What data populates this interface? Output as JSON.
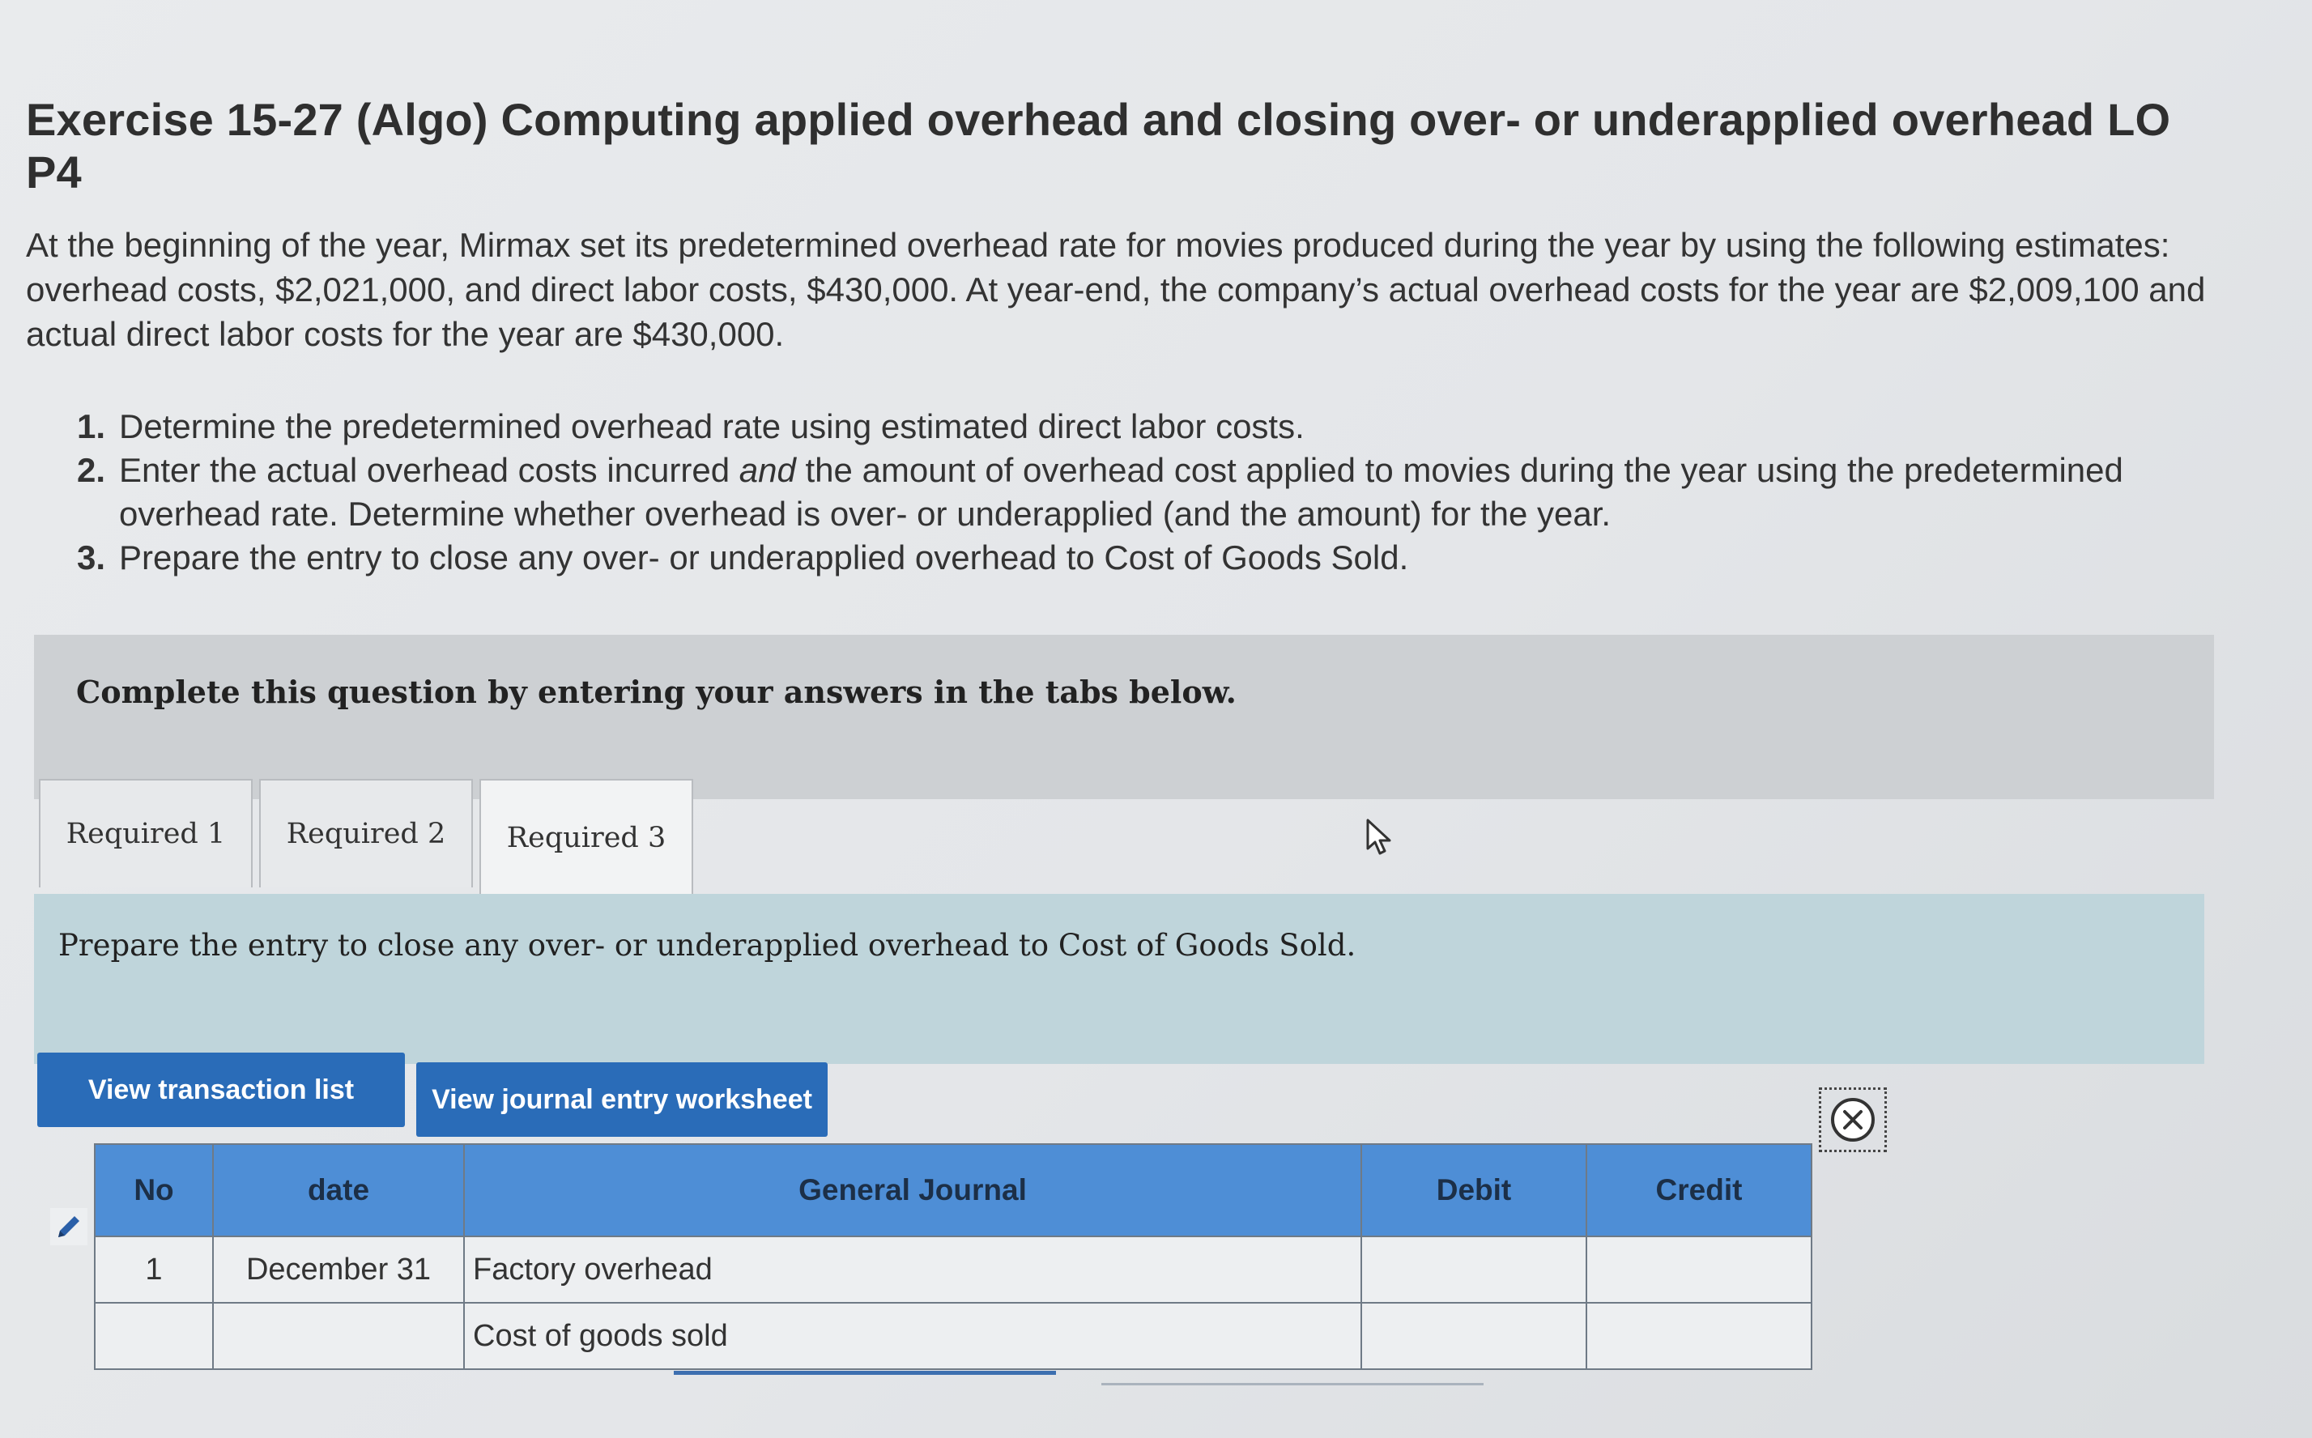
{
  "header": {
    "title": "Exercise 15-27 (Algo) Computing applied overhead and closing over- or underapplied overhead LO P4"
  },
  "problem": {
    "intro": "At the beginning of the year, Mirmax set its predetermined overhead rate for movies produced during the year by using the following estimates: overhead costs, $2,021,000, and direct labor costs, $430,000. At year-end, the company’s actual overhead costs for the year are $2,009,100 and actual direct labor costs for the year are $430,000.",
    "requirements": [
      {
        "num": "1.",
        "text": "Determine the predetermined overhead rate using estimated direct labor costs."
      },
      {
        "num": "2.",
        "text_before": "Enter the actual overhead costs incurred ",
        "text_em": "and",
        "text_after": " the amount of overhead cost applied to movies during the year using the predetermined overhead rate. Determine whether overhead is over- or underapplied (and the amount) for the year."
      },
      {
        "num": "3.",
        "text": "Prepare the entry to close any over- or underapplied overhead to Cost of Goods Sold."
      }
    ]
  },
  "banner": {
    "text": "Complete this question by entering your answers in the tabs below."
  },
  "tabs": [
    {
      "label": "Required 1",
      "active": false
    },
    {
      "label": "Required 2",
      "active": false
    },
    {
      "label": "Required 3",
      "active": true
    }
  ],
  "instruction": {
    "text": "Prepare the entry to close any over- or underapplied overhead to Cost of Goods Sold."
  },
  "buttons": {
    "view_transactions": "View transaction list",
    "view_worksheet": "View journal entry worksheet"
  },
  "journal": {
    "headers": {
      "no": "No",
      "date": "date",
      "general_journal": "General Journal",
      "debit": "Debit",
      "credit": "Credit"
    },
    "rows": [
      {
        "no": "1",
        "date": "December 31",
        "account": "Factory overhead",
        "debit": "",
        "credit": ""
      },
      {
        "no": "",
        "date": "",
        "account": "Cost of goods sold",
        "debit": "",
        "credit": ""
      }
    ]
  },
  "icons": {
    "edit": "pencil-icon",
    "close": "close-circle-icon",
    "cursor": "mouse-pointer-icon"
  },
  "colors": {
    "button_blue": "#2a6cb8",
    "table_header_blue": "#4e8ed6",
    "instruction_bg": "#bfd5db"
  }
}
